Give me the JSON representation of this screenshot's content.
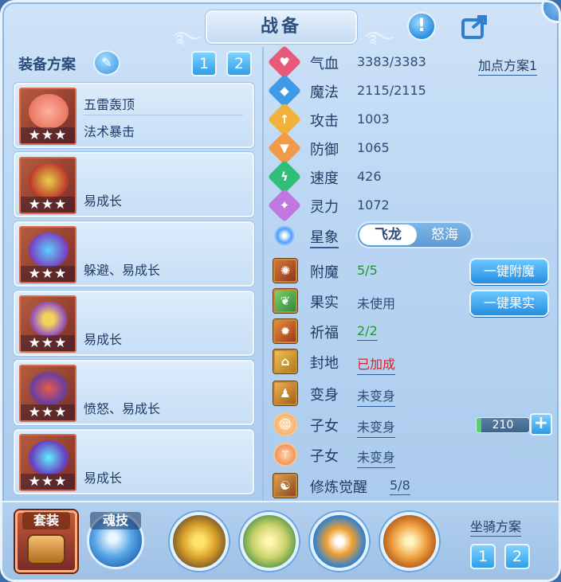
{
  "header": {
    "title": "战备",
    "help_icon": "exclamation-icon",
    "share_icon": "share-icon"
  },
  "equip_plan": {
    "label": "装备方案",
    "edit_icon": "pencil-icon",
    "plans": [
      "1",
      "2"
    ],
    "items": [
      {
        "line1": "五雷轰顶",
        "line2": "法术暴击",
        "stars": "★★★"
      },
      {
        "line1": "",
        "line2": "易成长",
        "stars": "★★★"
      },
      {
        "line1": "",
        "line2": "躲避、易成长",
        "stars": "★★★"
      },
      {
        "line1": "",
        "line2": "易成长",
        "stars": "★★★"
      },
      {
        "line1": "",
        "line2": "愤怒、易成长",
        "stars": "★★★"
      },
      {
        "line1": "",
        "line2": "易成长",
        "stars": "★★★"
      }
    ]
  },
  "stats": [
    {
      "label": "气血",
      "value": "3383/3383",
      "color": "#e85a7a"
    },
    {
      "label": "魔法",
      "value": "2115/2115",
      "color": "#3f9ae8"
    },
    {
      "label": "攻击",
      "value": "1003",
      "color": "#f0b23a"
    },
    {
      "label": "防御",
      "value": "1065",
      "color": "#f09a4a"
    },
    {
      "label": "速度",
      "value": "426",
      "color": "#2fbf78"
    },
    {
      "label": "灵力",
      "value": "1072",
      "color": "#c077e0"
    }
  ],
  "point_plan": "加点方案1",
  "xingxiang": {
    "label": "星象",
    "options": [
      "飞龙",
      "怒海"
    ]
  },
  "rows": [
    {
      "label": "附魔",
      "value": "5/5"
    },
    {
      "label": "果实",
      "value": "未使用"
    },
    {
      "label": "祈福",
      "value": "2/2"
    },
    {
      "label": "封地",
      "value": "已加成"
    },
    {
      "label": "变身",
      "value": "未变身"
    },
    {
      "label": "子女",
      "value": "未变身"
    },
    {
      "label": "子女",
      "value": "未变身"
    },
    {
      "label": "修炼觉醒",
      "value": "5/8"
    }
  ],
  "buttons": {
    "enchant": "一键附魔",
    "fruit": "一键果实"
  },
  "child_bar": {
    "value": "210",
    "plus": "+"
  },
  "bottom": {
    "set_label": "套装",
    "skill_label": "魂技",
    "mount_title": "坐骑方案",
    "mount_plans": [
      "1",
      "2"
    ]
  }
}
